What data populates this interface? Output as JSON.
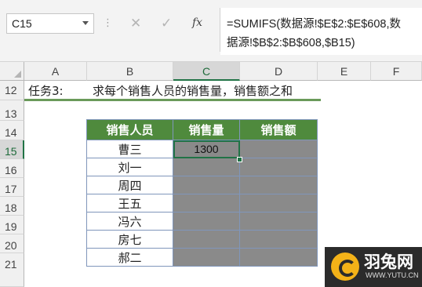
{
  "formula_bar": {
    "name_box": "C15",
    "separator": "⋮",
    "cancel_glyph": "✕",
    "enter_glyph": "✓",
    "fx_glyph": "fx",
    "formula_line1": "=SUMIFS(数据源!$E$2:$E$608,数",
    "formula_line2": "据源!$B$2:$B$608,$B15)"
  },
  "columns": [
    "A",
    "B",
    "C",
    "D",
    "E",
    "F"
  ],
  "selected_column": "C",
  "rows": [
    "12",
    "13",
    "14",
    "15",
    "16",
    "17",
    "18",
    "19",
    "20",
    "21"
  ],
  "selected_row": "15",
  "task": {
    "label": "任务3:",
    "description": "求每个销售人员的销售量，销售额之和"
  },
  "table": {
    "headers": [
      "销售人员",
      "销售量",
      "销售额"
    ],
    "rows": [
      {
        "name": "曹三",
        "qty": "1300",
        "amount": ""
      },
      {
        "name": "刘一",
        "qty": "",
        "amount": ""
      },
      {
        "name": "周四",
        "qty": "",
        "amount": ""
      },
      {
        "name": "王五",
        "qty": "",
        "amount": ""
      },
      {
        "name": "冯六",
        "qty": "",
        "amount": ""
      },
      {
        "name": "房七",
        "qty": "",
        "amount": ""
      },
      {
        "name": "郝二",
        "qty": "",
        "amount": ""
      }
    ]
  },
  "watermark": {
    "brand": "羽兔网",
    "url": "WWW.YUTU.CN"
  },
  "colors": {
    "accent_green": "#217346",
    "header_green": "#4f8a3d",
    "cell_gray": "#8a8a8a",
    "logo_yellow": "#f3b218"
  }
}
